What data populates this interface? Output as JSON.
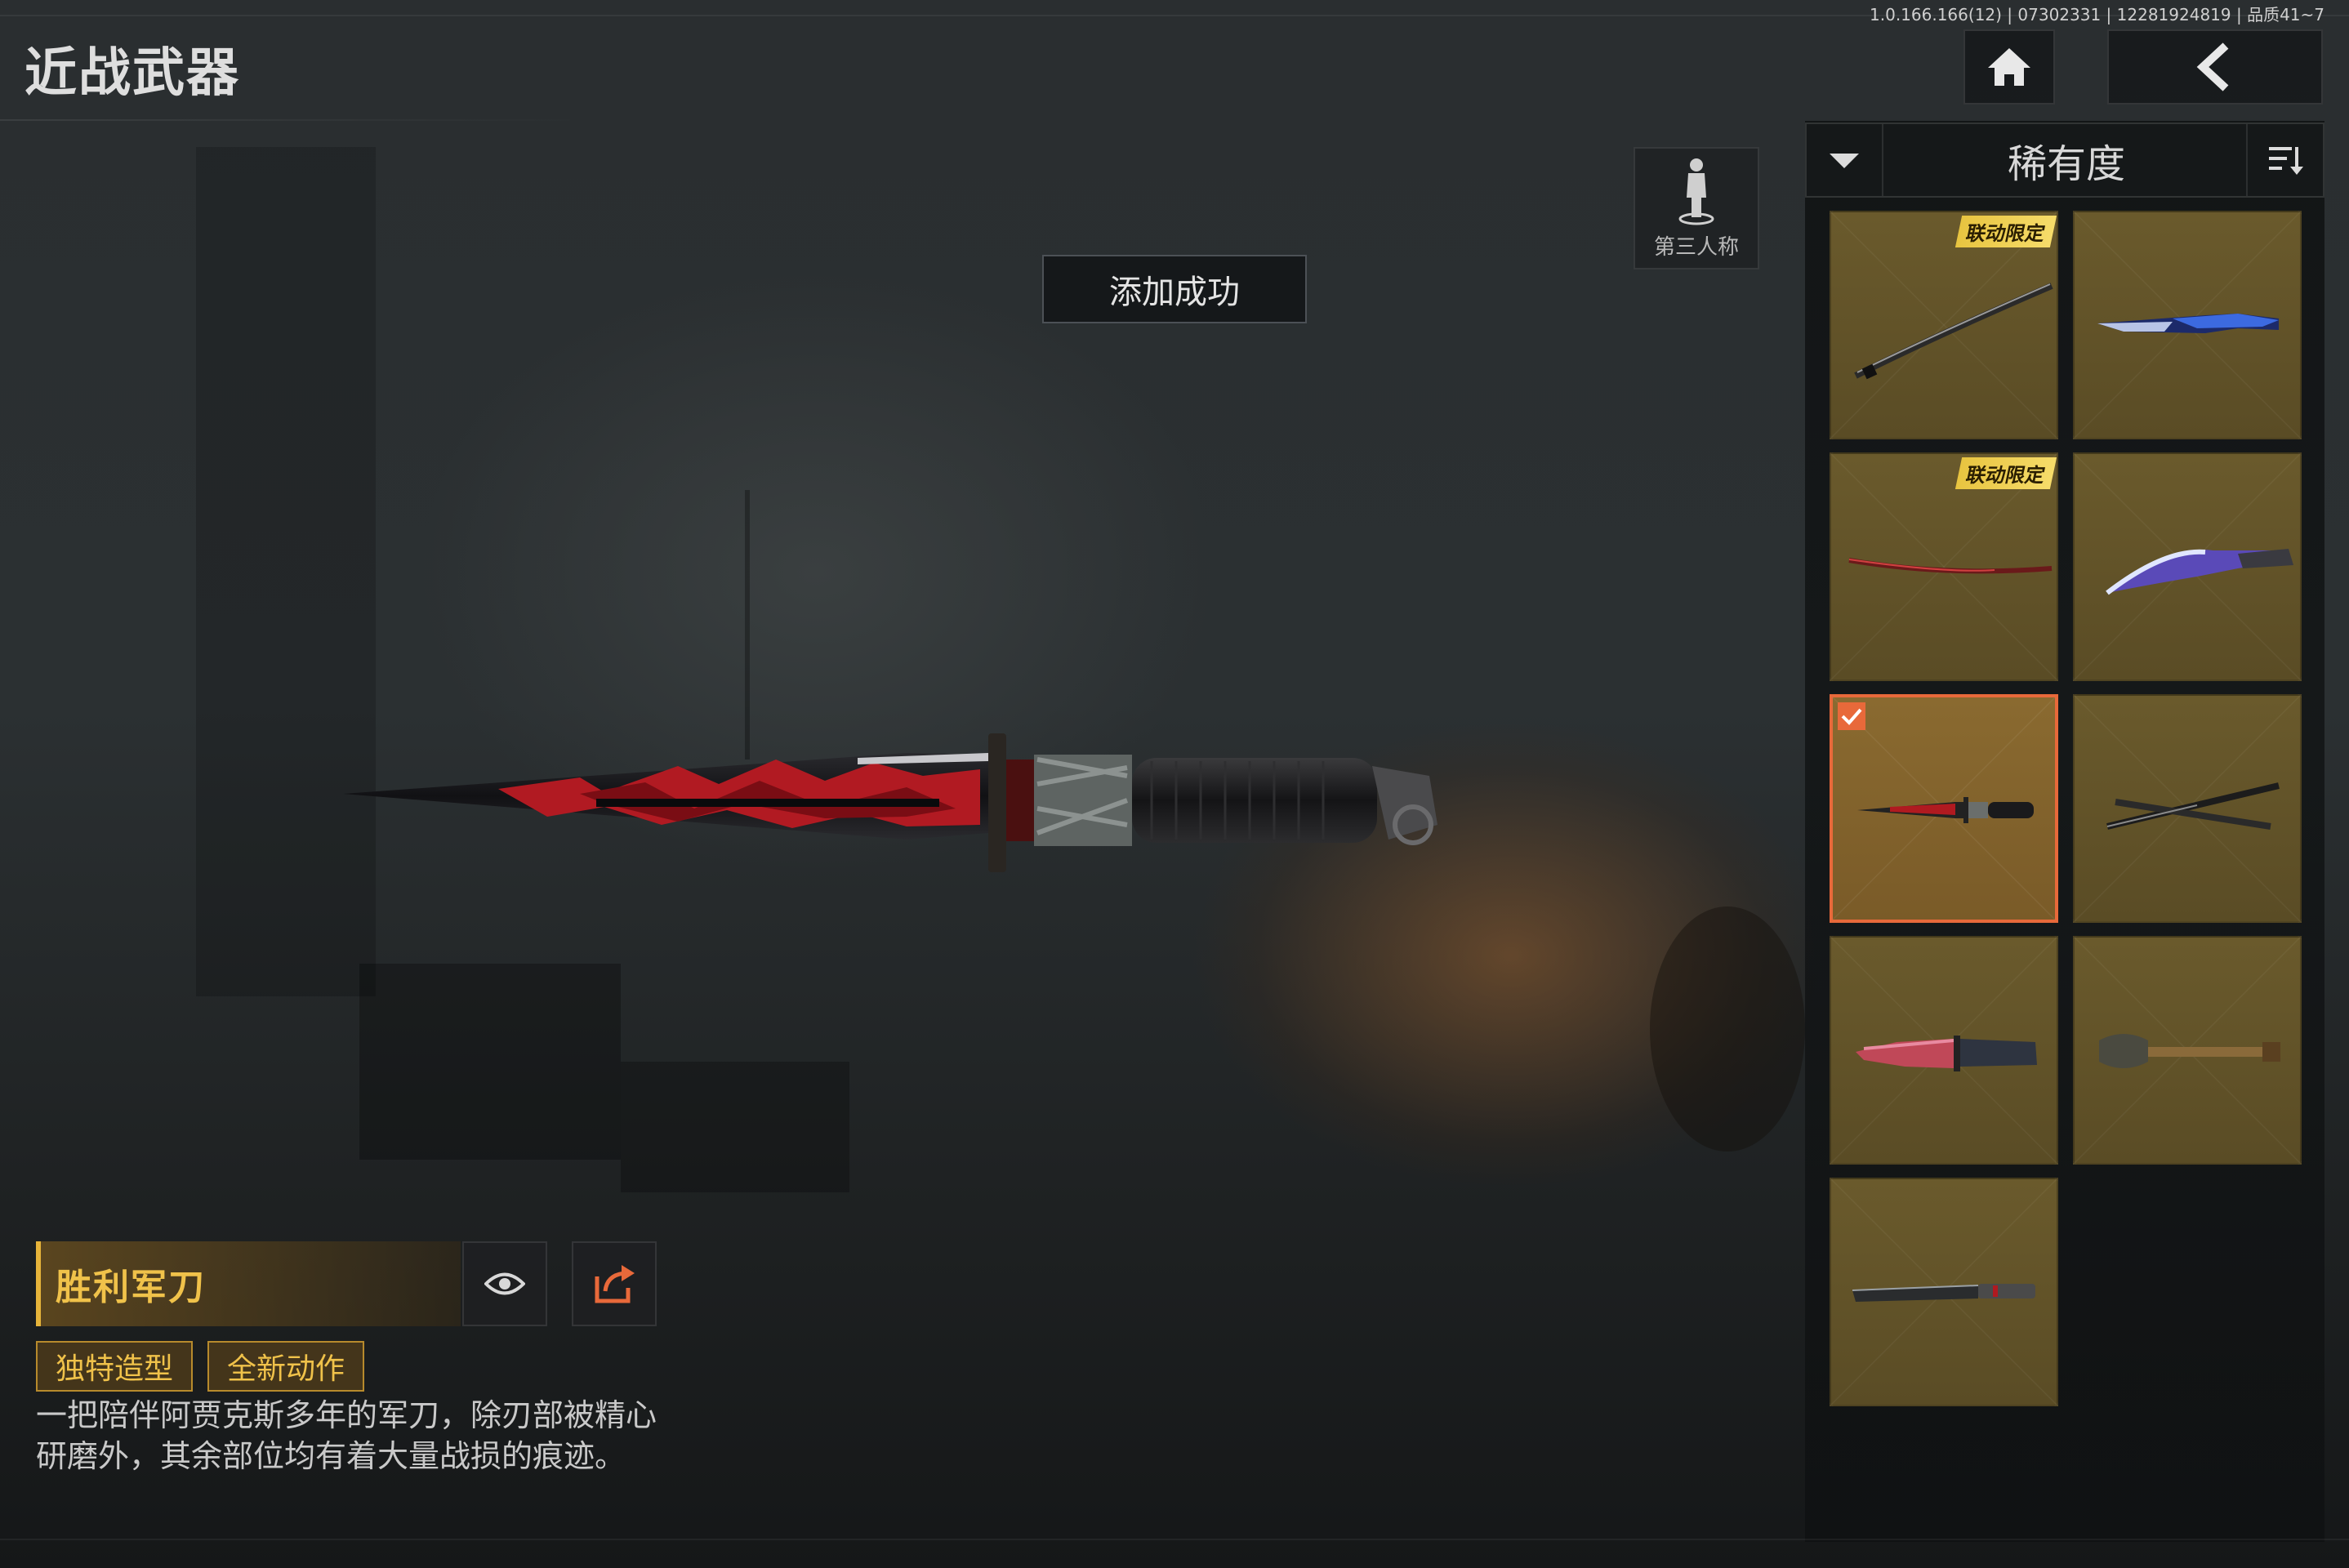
{
  "version_info": "1.0.166.166(12) | 07302331 | 12281924819 | 品质41~7",
  "page_title": "近战武器",
  "toast": "添加成功",
  "camera_toggle": {
    "label": "第三人称"
  },
  "sort": {
    "label": "稀有度"
  },
  "weapon": {
    "name": "胜利军刀",
    "tags": [
      "独特造型",
      "全新动作"
    ],
    "description": "一把陪伴阿贾克斯多年的军刀，除刃部被精心研磨外，其余部位均有着大量战损的痕迹。"
  },
  "grid": [
    {
      "badge": "联动限定",
      "icon": "katana-icon",
      "selected": false
    },
    {
      "badge": "",
      "icon": "blue-machete-icon",
      "selected": false
    },
    {
      "badge": "联动限定",
      "icon": "red-sword-icon",
      "selected": false
    },
    {
      "badge": "",
      "icon": "kukri-icon",
      "selected": false
    },
    {
      "badge": "",
      "icon": "combat-knife-icon",
      "selected": true
    },
    {
      "badge": "",
      "icon": "crossed-blades-icon",
      "selected": false
    },
    {
      "badge": "",
      "icon": "serrated-knife-icon",
      "selected": false
    },
    {
      "badge": "",
      "icon": "shovel-icon",
      "selected": false
    },
    {
      "badge": "",
      "icon": "machete-icon",
      "selected": false
    }
  ],
  "colors": {
    "accent": "#e8693a",
    "gold": "#f0c24a",
    "tile": "#6a5a2c"
  }
}
